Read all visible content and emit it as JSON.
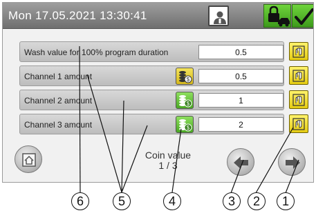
{
  "header": {
    "datetime": "Mon 17.05.2021  13:30:41",
    "icons": [
      "user-icon",
      "lock-car-icon",
      "checkmark-icon"
    ]
  },
  "rows": [
    {
      "label": "Wash value for 100% program duration",
      "value": "0.5",
      "coin_icon": null
    },
    {
      "label": "Channel 1 amount",
      "value": "0.5",
      "coin_icon": "coins-yellow"
    },
    {
      "label": "Channel 2 amount",
      "value": "1",
      "coin_icon": "coins-green"
    },
    {
      "label": "Channel 3 amount",
      "value": "2",
      "coin_icon": "coins-green"
    }
  ],
  "pager": {
    "title": "Coin value",
    "position": "1 / 3"
  },
  "callouts": [
    "1",
    "2",
    "3",
    "4",
    "5",
    "6"
  ],
  "colors": {
    "header": "#8a8a8a",
    "edit_button": "#f2e13a",
    "ok_button": "#4fb228",
    "row": "#c8c8c8"
  }
}
